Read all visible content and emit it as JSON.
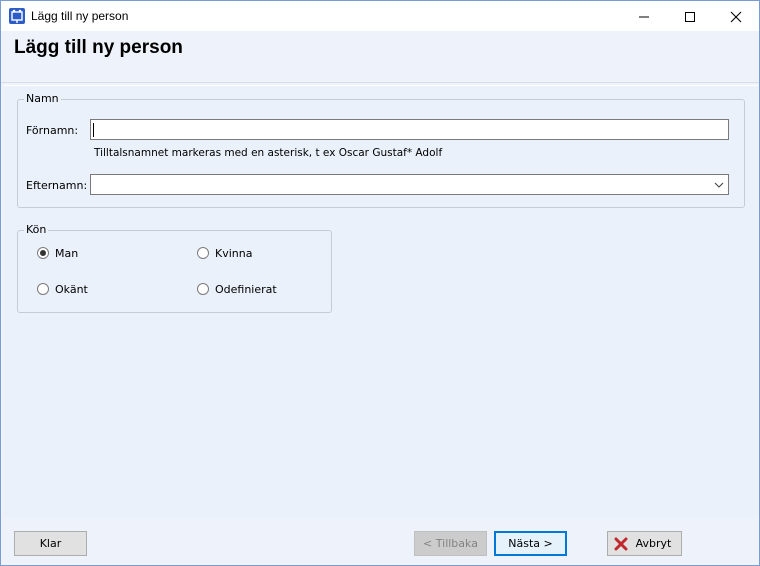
{
  "window": {
    "title": "Lägg till ny person",
    "controls": [
      "minimize-icon",
      "maximize-icon",
      "close-icon"
    ]
  },
  "header": {
    "title": "Lägg till ny person"
  },
  "name_group": {
    "legend": "Namn",
    "first_name_label": "Förnamn:",
    "first_name_value": "",
    "hint": "Tilltalsnamnet markeras med en asterisk, t ex  Oscar Gustaf* Adolf",
    "last_name_label": "Efternamn:",
    "last_name_value": ""
  },
  "gender_group": {
    "legend": "Kön",
    "options": [
      {
        "label": "Man",
        "checked": true
      },
      {
        "label": "Kvinna",
        "checked": false
      },
      {
        "label": "Okänt",
        "checked": false
      },
      {
        "label": "Odefinierat",
        "checked": false
      }
    ]
  },
  "footer": {
    "done_label": "Klar",
    "back_label": "< Tillbaka",
    "next_label": "Nästa >",
    "cancel_label": "Avbryt"
  },
  "colors": {
    "accent": "#0078d7",
    "background": "#eaf1fa",
    "cancel_icon": "#c0282d"
  }
}
